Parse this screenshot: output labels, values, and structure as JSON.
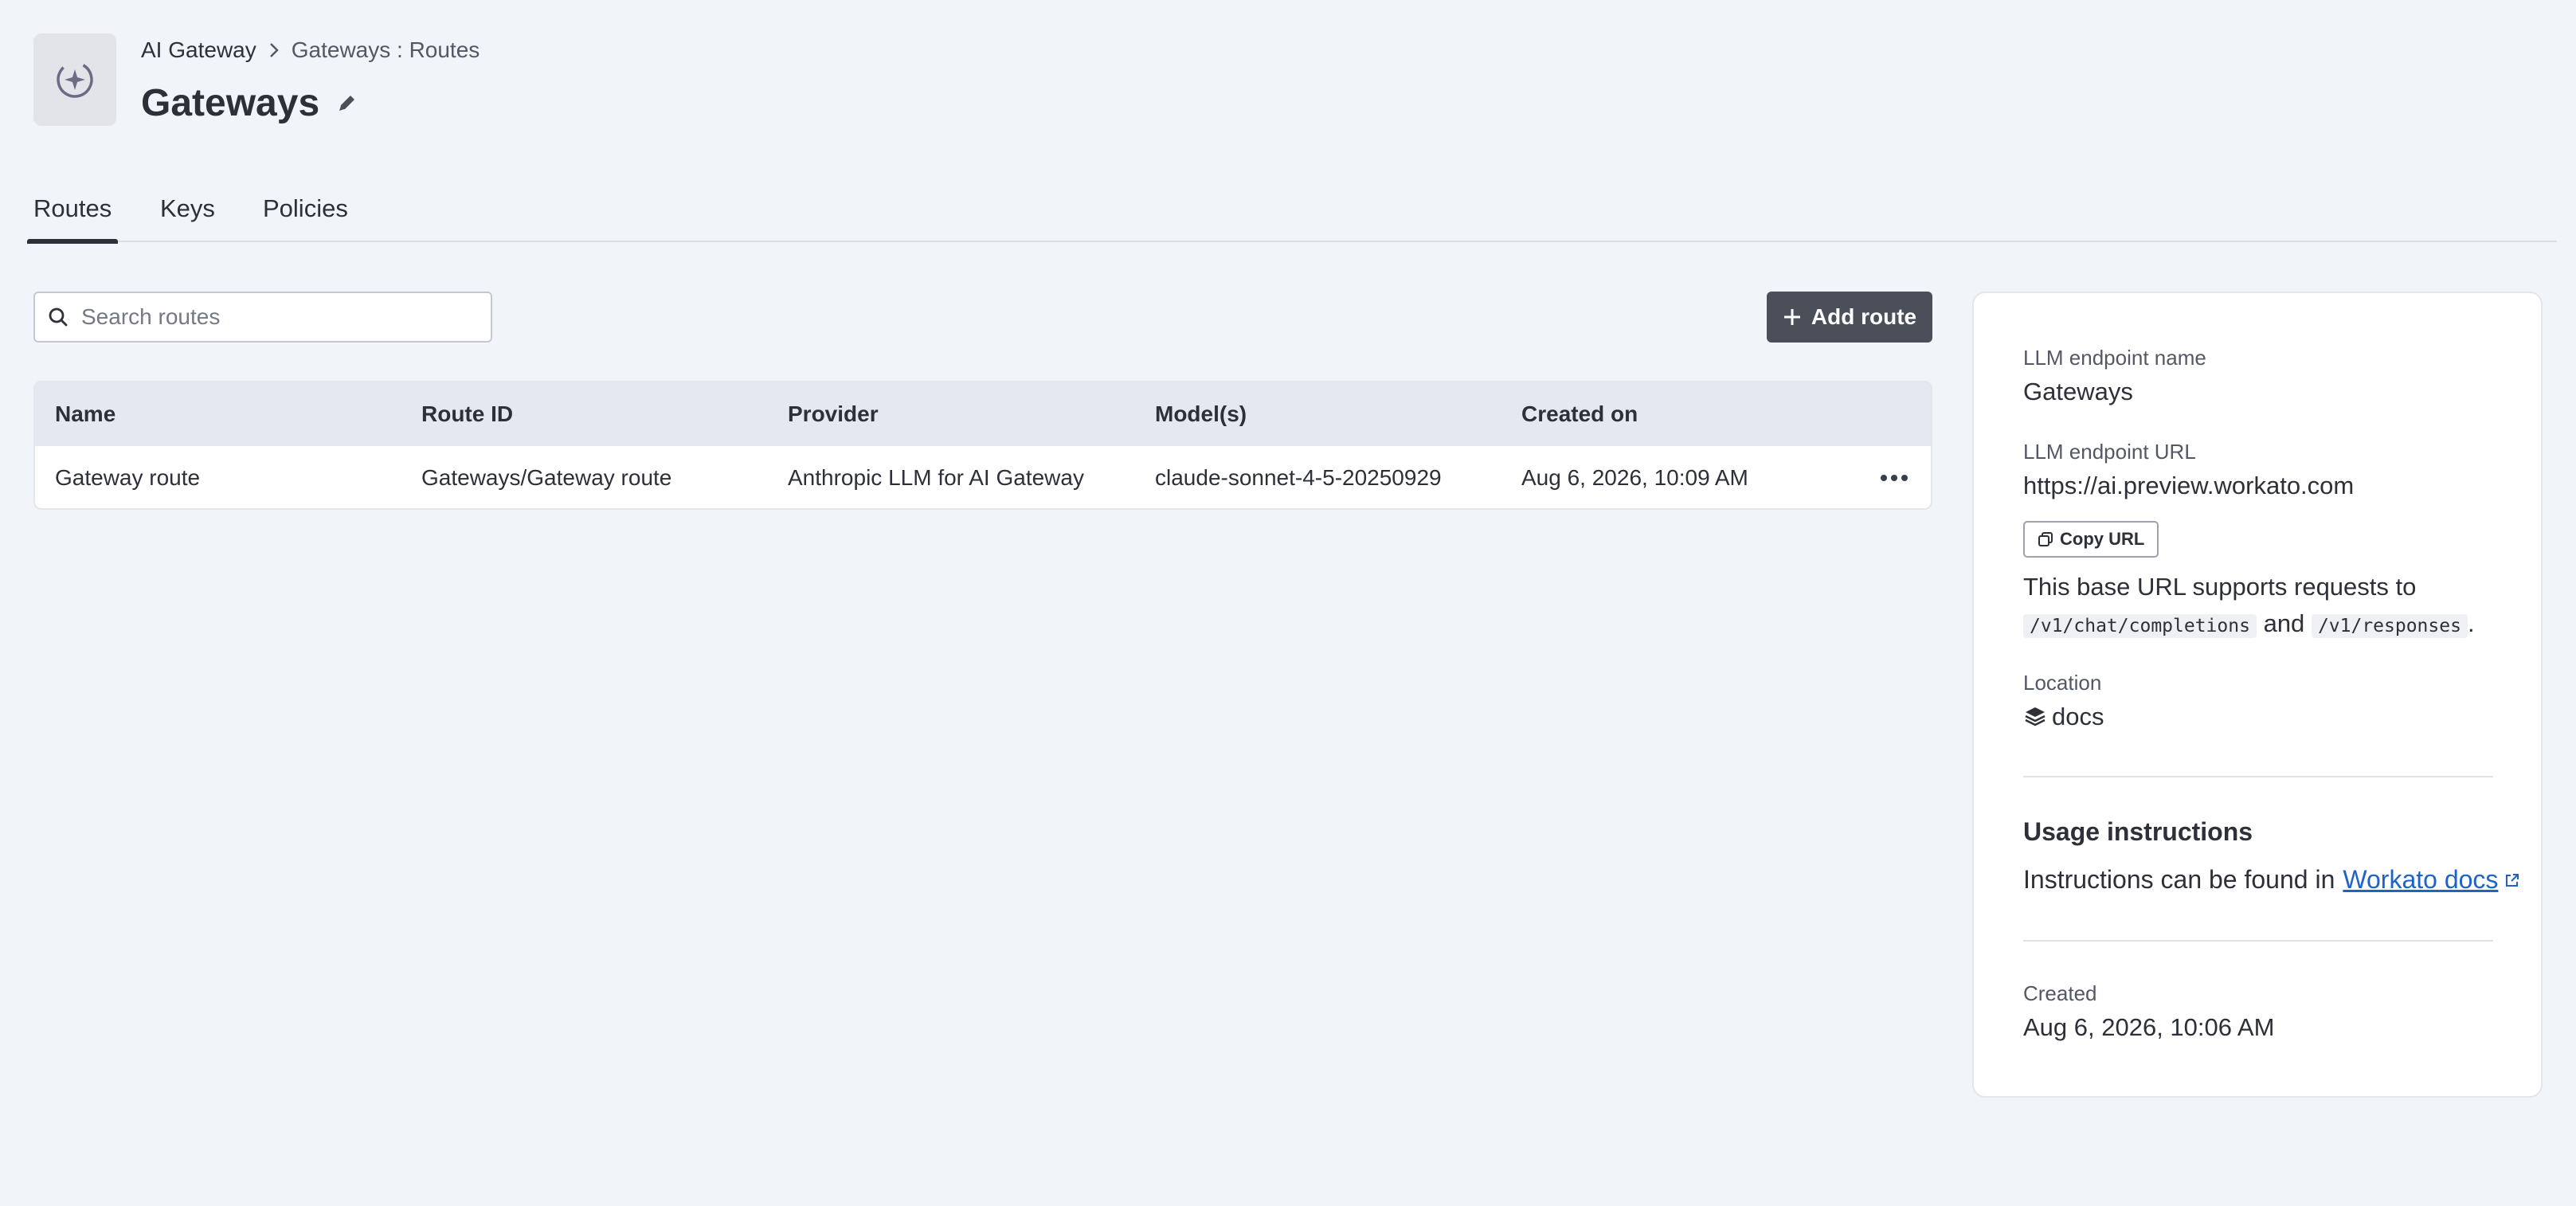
{
  "breadcrumb": {
    "parent": "AI Gateway",
    "current": "Gateways : Routes"
  },
  "page_title": "Gateways",
  "tabs": [
    {
      "label": "Routes",
      "active": true
    },
    {
      "label": "Keys",
      "active": false
    },
    {
      "label": "Policies",
      "active": false
    }
  ],
  "search": {
    "placeholder": "Search routes",
    "value": ""
  },
  "add_route_label": "Add route",
  "table": {
    "columns": [
      "Name",
      "Route ID",
      "Provider",
      "Model(s)",
      "Created on"
    ],
    "rows": [
      {
        "name": "Gateway route",
        "route_id": "Gateways/Gateway route",
        "provider": "Anthropic LLM for AI Gateway",
        "models": "claude-sonnet-4-5-20250929",
        "created_on": "Aug 6, 2026, 10:09 AM"
      }
    ]
  },
  "panel": {
    "endpoint_name_label": "LLM endpoint name",
    "endpoint_name": "Gateways",
    "endpoint_url_label": "LLM endpoint URL",
    "endpoint_url": "https://ai.preview.workato.com",
    "copy_url_label": "Copy URL",
    "desc_prefix": "This base URL supports requests to",
    "path_1": "/v1/chat/completions",
    "desc_and": "and",
    "path_2": "/v1/responses",
    "desc_suffix": ".",
    "location_label": "Location",
    "location": "docs",
    "usage_title": "Usage instructions",
    "usage_text": "Instructions can be found in",
    "usage_link": "Workato docs",
    "created_label": "Created",
    "created": "Aug 6, 2026, 10:06 AM"
  },
  "icons": {
    "app": "ai-sparkle-icon",
    "breadcrumb_sep": "chevron-right-icon",
    "edit": "pencil-icon",
    "search": "search-icon",
    "add": "plus-icon",
    "row_menu": "more-horizontal-icon",
    "copy": "copy-icon",
    "location": "stack-icon",
    "external": "external-link-icon"
  },
  "colors": {
    "background": "#f1f4f9",
    "primary_button": "#4a4f59",
    "link": "#1f63c6"
  }
}
